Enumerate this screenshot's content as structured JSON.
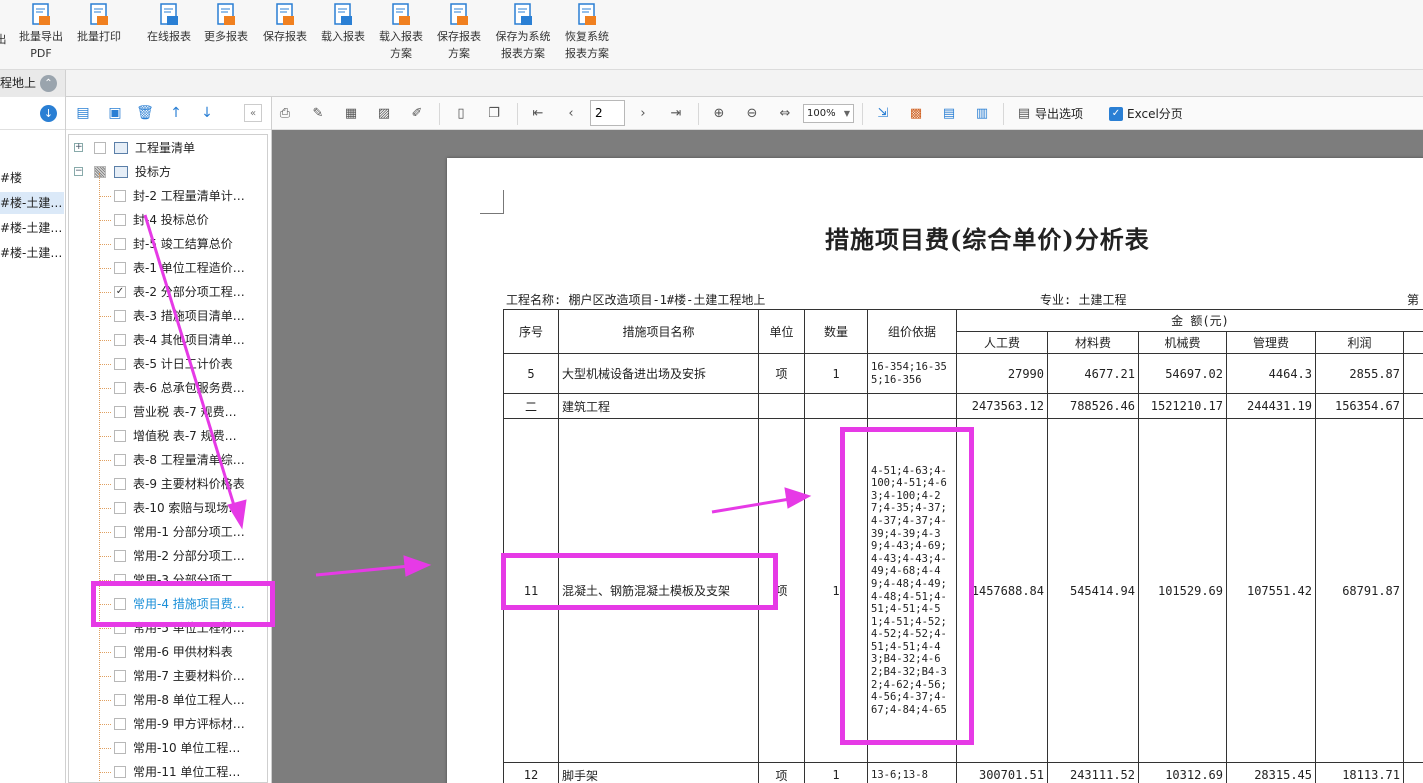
{
  "ribbon": {
    "buttons": [
      {
        "label": "出",
        "icon": "export-icon"
      },
      {
        "label": "批量导出\nPDF",
        "icon": "pdf-export-icon"
      },
      {
        "label": "批量打印",
        "icon": "batch-print-icon"
      },
      {
        "label": "在线报表",
        "icon": "online-report-icon"
      },
      {
        "label": "更多报表",
        "icon": "more-reports-icon"
      },
      {
        "label": "保存报表",
        "icon": "save-report-icon"
      },
      {
        "label": "载入报表",
        "icon": "load-report-icon"
      },
      {
        "label": "载入报表\n方案",
        "icon": "load-scheme-icon"
      },
      {
        "label": "保存报表\n方案",
        "icon": "save-scheme-icon"
      },
      {
        "label": "保存为系统\n报表方案",
        "icon": "save-system-scheme-icon"
      },
      {
        "label": "恢复系统\n报表方案",
        "icon": "restore-system-scheme-icon"
      }
    ]
  },
  "strip": {
    "tab_label": "程地上"
  },
  "left_pane": {
    "items": [
      "#楼",
      "#楼-土建…",
      "#楼-土建…",
      "#楼-土建…"
    ]
  },
  "tree": {
    "roots": [
      {
        "label": "工程量清单"
      },
      {
        "label": "投标方"
      }
    ],
    "children": [
      {
        "label": "封-2 工程量清单计…",
        "checked": false
      },
      {
        "label": "封-4 投标总价",
        "checked": false
      },
      {
        "label": "封-5 竣工结算总价",
        "checked": false
      },
      {
        "label": "表-1 单位工程造价…",
        "checked": false
      },
      {
        "label": "表-2 分部分项工程…",
        "checked": true
      },
      {
        "label": "表-3 措施项目清单…",
        "checked": false
      },
      {
        "label": "表-4 其他项目清单…",
        "checked": false
      },
      {
        "label": "表-5 计日工计价表",
        "checked": false
      },
      {
        "label": "表-6 总承包服务费…",
        "checked": false
      },
      {
        "label": "营业税 表-7 规费…",
        "checked": false
      },
      {
        "label": "增值税 表-7 规费…",
        "checked": false
      },
      {
        "label": "表-8 工程量清单综…",
        "checked": false
      },
      {
        "label": "表-9 主要材料价格表",
        "checked": false
      },
      {
        "label": "表-10 索赔与现场…",
        "checked": false
      },
      {
        "label": "常用-1 分部分项工…",
        "checked": false
      },
      {
        "label": "常用-2 分部分项工…",
        "checked": false
      },
      {
        "label": "常用-3 分部分项工…",
        "checked": false
      },
      {
        "label": "常用-4 措施项目费…",
        "checked": false,
        "active": true
      },
      {
        "label": "常用-5 单位工程材…",
        "checked": false
      },
      {
        "label": "常用-6 甲供材料表",
        "checked": false
      },
      {
        "label": "常用-7 主要材料价…",
        "checked": false
      },
      {
        "label": "常用-8 单位工程人…",
        "checked": false
      },
      {
        "label": "常用-9 甲方评标材…",
        "checked": false
      },
      {
        "label": "常用-10 单位工程…",
        "checked": false
      },
      {
        "label": "常用-11 单位工程…",
        "checked": false
      }
    ]
  },
  "toolbar": {
    "page_value": "2",
    "zoom_value": "100%",
    "export_options_label": "导出选项",
    "excel_paging_label": "Excel分页",
    "excel_paging_checked": true
  },
  "report": {
    "title": "措施项目费(综合单价)分析表",
    "project_name": "工程名称: 棚户区改造项目-1#楼-土建工程地上",
    "specialty": "专业: 土建工程",
    "page_label": "第",
    "headers": {
      "seq": "序号",
      "item_name": "措施项目名称",
      "unit": "单位",
      "qty": "数量",
      "basis": "组价依据",
      "amount_group": "金 额(元)",
      "labor": "人工费",
      "material": "材料费",
      "machine": "机械费",
      "management": "管理费",
      "profit": "利润"
    },
    "rows": [
      {
        "seq": "5",
        "name": "大型机械设备进出场及安拆",
        "unit": "项",
        "qty": "1",
        "basis": "16-354;16-355;16-356",
        "labor": "27990",
        "material": "4677.21",
        "machine": "54697.02",
        "management": "4464.3",
        "profit": "2855.87"
      },
      {
        "seq": "二",
        "name": "建筑工程",
        "unit": "",
        "qty": "",
        "basis": "",
        "labor": "2473563.12",
        "material": "788526.46",
        "machine": "1521210.17",
        "management": "244431.19",
        "profit": "156354.67"
      },
      {
        "seq": "11",
        "name": "混凝土、钢筋混凝土模板及支架",
        "unit": "项",
        "qty": "1",
        "basis": "4-51;4-63;4-100;4-51;4-63;4-100;4-27;4-35;4-37;4-37;4-37;4-39;4-39;4-39;4-43;4-69;4-43;4-43;4-49;4-68;4-49;4-48;4-49;4-48;4-51;4-51;4-51;4-51;4-51;4-52;4-52;4-52;4-51;4-51;4-43;B4-32;4-62;B4-32;B4-32;4-62;4-56;4-56;4-37;4-67;4-84;4-65",
        "labor": "1457688.84",
        "material": "545414.94",
        "machine": "101529.69",
        "management": "107551.42",
        "profit": "68791.87"
      },
      {
        "seq": "12",
        "name": "脚手架",
        "unit": "项",
        "qty": "1",
        "basis": "13-6;13-8",
        "labor": "300701.51",
        "material": "243111.52",
        "machine": "10312.69",
        "management": "28315.45",
        "profit": "18113.71"
      }
    ]
  },
  "annotation": {
    "color": "#e63ae6"
  }
}
